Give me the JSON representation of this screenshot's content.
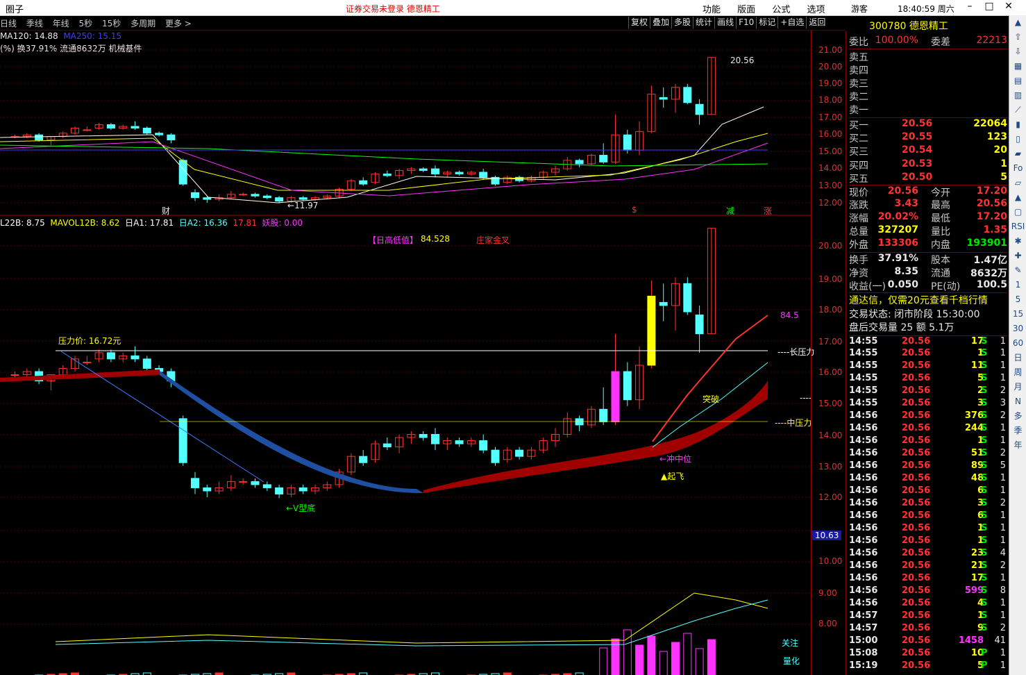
{
  "titlebar": {
    "app_name": "圈子",
    "notice": "证券交易未登录  德恩精工",
    "menus": [
      "功能",
      "版面",
      "公式",
      "选项"
    ],
    "guest": "游客",
    "clock": "18:40:59 周六",
    "win_buttons": [
      "–",
      "□",
      "✕"
    ]
  },
  "toolbar": {
    "periods": [
      "日线",
      "季线",
      "年线",
      "5秒",
      "15秒",
      "多周期",
      "更多 >"
    ],
    "tools": [
      "复权",
      "叠加",
      "多股",
      "统计",
      "画线",
      "F10",
      "标记",
      "+自选",
      "返回"
    ]
  },
  "chart": {
    "ma_line1": {
      "ma120": "MA120: 14.88",
      "ma250": "MA250: 15.15"
    },
    "ma_line2": "(%) 换37.91% 流通8632万  机械基件",
    "top_labels": {
      "high": "20.56",
      "low": "11.97",
      "cai": "财",
      "s": "$",
      "jian": "减",
      "zhang": "涨"
    },
    "price_axis": [
      "21.00",
      "20.00",
      "19.00",
      "18.00",
      "17.00",
      "16.00",
      "15.00",
      "14.00",
      "13.00",
      "12.00"
    ],
    "ind_axis": [
      "20.00",
      "19.00",
      "18.00",
      "17.00",
      "16.00",
      "15.00",
      "14.00",
      "13.00",
      "12.00",
      "10.63",
      "10.00",
      "9.00",
      "8.00"
    ],
    "ind_header": {
      "l22b": "L22B: 8.75",
      "mavol": "MAVOL12B: 8.62",
      "a1": "日A1: 17.81",
      "a2": "日A2: 16.36",
      "a3": "17.81",
      "yao": "妖股: 0.00"
    },
    "ind_labels": {
      "gaodi": "【日高低值】",
      "gaodi_val": "84.528",
      "zhuang": "庄家金叉",
      "pressure": "压力价: 16.72元",
      "long": "----长压力",
      "mid": "----中压力",
      "breakout": "突破",
      "chong": "←冲中位",
      "qifei": "▲起飞",
      "vdi": "←V型底",
      "val845": "84.5",
      "guanzhu": "关注",
      "lianghua": "量化",
      "dash": "----"
    }
  },
  "quote": {
    "code": "300780 德恩精工",
    "weibi": {
      "label": "委比",
      "val": "100.00%",
      "label2": "委差",
      "val2": "22213"
    },
    "asks": [
      "卖五",
      "卖四",
      "卖三",
      "卖二",
      "卖一"
    ],
    "bids": [
      {
        "label": "买一",
        "price": "20.56",
        "vol": "22064"
      },
      {
        "label": "买二",
        "price": "20.55",
        "vol": "123"
      },
      {
        "label": "买三",
        "price": "20.54",
        "vol": "20"
      },
      {
        "label": "买四",
        "price": "20.53",
        "vol": "1"
      },
      {
        "label": "买五",
        "price": "20.50",
        "vol": "5"
      }
    ],
    "stats": [
      {
        "l": "现价",
        "v": "20.56",
        "vc": "red",
        "l2": "今开",
        "v2": "17.20",
        "v2c": "red"
      },
      {
        "l": "涨跌",
        "v": "3.43",
        "vc": "red",
        "l2": "最高",
        "v2": "20.56",
        "v2c": "red"
      },
      {
        "l": "涨幅",
        "v": "20.02%",
        "vc": "red",
        "l2": "最低",
        "v2": "17.20",
        "v2c": "red"
      },
      {
        "l": "总量",
        "v": "327207",
        "vc": "yellow",
        "l2": "量比",
        "v2": "1.35",
        "v2c": "red"
      },
      {
        "l": "外盘",
        "v": "133306",
        "vc": "red",
        "l2": "内盘",
        "v2": "193901",
        "v2c": "green"
      },
      {
        "l": "换手",
        "v": "37.91%",
        "vc": "white",
        "l2": "股本",
        "v2": "1.47亿",
        "v2c": "white"
      },
      {
        "l": "净资",
        "v": "8.35",
        "vc": "white",
        "l2": "流通",
        "v2": "8632万",
        "v2c": "white"
      },
      {
        "l": "收益(一)",
        "v": "0.050",
        "vc": "white",
        "l2": "PE(动)",
        "v2": "100.5",
        "v2c": "white"
      }
    ],
    "ad": "通达信，仅需20元查看千档行情",
    "status": "交易状态: 闭市阶段 15:30:00",
    "after": "盘后交易量 25 额 5.1万",
    "ticks": [
      {
        "t": "14:55",
        "p": "20.56",
        "q": "17",
        "qc": "yellow",
        "s": "S",
        "n": "1"
      },
      {
        "t": "14:55",
        "p": "20.56",
        "q": "1",
        "qc": "yellow",
        "s": "S",
        "n": "1"
      },
      {
        "t": "14:55",
        "p": "20.56",
        "q": "11",
        "qc": "yellow",
        "s": "S",
        "n": "1"
      },
      {
        "t": "14:55",
        "p": "20.56",
        "q": "5",
        "qc": "yellow",
        "s": "S",
        "n": "1"
      },
      {
        "t": "14:55",
        "p": "20.56",
        "q": "2",
        "qc": "yellow",
        "s": "S",
        "n": "2"
      },
      {
        "t": "14:55",
        "p": "20.56",
        "q": "3",
        "qc": "yellow",
        "s": "S",
        "n": "3"
      },
      {
        "t": "14:56",
        "p": "20.56",
        "q": "376",
        "qc": "yellow",
        "s": "S",
        "n": "2"
      },
      {
        "t": "14:56",
        "p": "20.56",
        "q": "244",
        "qc": "yellow",
        "s": "S",
        "n": "1"
      },
      {
        "t": "14:56",
        "p": "20.56",
        "q": "1",
        "qc": "yellow",
        "s": "S",
        "n": "1"
      },
      {
        "t": "14:56",
        "p": "20.56",
        "q": "51",
        "qc": "yellow",
        "s": "S",
        "n": "2"
      },
      {
        "t": "14:56",
        "p": "20.56",
        "q": "89",
        "qc": "yellow",
        "s": "S",
        "n": "5"
      },
      {
        "t": "14:56",
        "p": "20.56",
        "q": "48",
        "qc": "yellow",
        "s": "S",
        "n": "1"
      },
      {
        "t": "14:56",
        "p": "20.56",
        "q": "6",
        "qc": "yellow",
        "s": "S",
        "n": "1"
      },
      {
        "t": "14:56",
        "p": "20.56",
        "q": "3",
        "qc": "yellow",
        "s": "S",
        "n": "2"
      },
      {
        "t": "14:56",
        "p": "20.56",
        "q": "6",
        "qc": "yellow",
        "s": "S",
        "n": "1"
      },
      {
        "t": "14:56",
        "p": "20.56",
        "q": "1",
        "qc": "yellow",
        "s": "S",
        "n": "1"
      },
      {
        "t": "14:56",
        "p": "20.56",
        "q": "1",
        "qc": "yellow",
        "s": "S",
        "n": "1"
      },
      {
        "t": "14:56",
        "p": "20.56",
        "q": "23",
        "qc": "yellow",
        "s": "S",
        "n": "4"
      },
      {
        "t": "14:56",
        "p": "20.56",
        "q": "21",
        "qc": "yellow",
        "s": "S",
        "n": "2"
      },
      {
        "t": "14:56",
        "p": "20.56",
        "q": "17",
        "qc": "yellow",
        "s": "S",
        "n": "1"
      },
      {
        "t": "14:56",
        "p": "20.56",
        "q": "599",
        "qc": "magenta",
        "s": "S",
        "n": "8"
      },
      {
        "t": "14:56",
        "p": "20.56",
        "q": "4",
        "qc": "yellow",
        "s": "S",
        "n": "1"
      },
      {
        "t": "14:57",
        "p": "20.56",
        "q": "1",
        "qc": "yellow",
        "s": "S",
        "n": "1"
      },
      {
        "t": "14:57",
        "p": "20.56",
        "q": "9",
        "qc": "yellow",
        "s": "S",
        "n": "2"
      },
      {
        "t": "15:00",
        "p": "20.56",
        "q": "1458",
        "qc": "magenta",
        "s": "",
        "n": "41"
      },
      {
        "t": "15:08",
        "p": "20.56",
        "q": "10",
        "qc": "yellow",
        "s": "P",
        "n": "1"
      },
      {
        "t": "15:19",
        "p": "20.56",
        "q": "5",
        "qc": "yellow",
        "s": "P",
        "n": "1"
      }
    ]
  },
  "iconbar": [
    "▲",
    "⇧",
    "⇩",
    "▦",
    "▤",
    "▥",
    "⟋",
    "▮",
    "▯",
    "▰",
    "Fo",
    "▱",
    "▲",
    "▢",
    "RSI",
    "✱",
    "✚",
    "✎",
    "1",
    "5",
    "15",
    "30",
    "60",
    "日",
    "周",
    "月",
    "N",
    "多",
    "季",
    "年"
  ],
  "colors": {
    "up": "#ff3232",
    "down": "#54ffff",
    "accent": "#ffff00"
  }
}
